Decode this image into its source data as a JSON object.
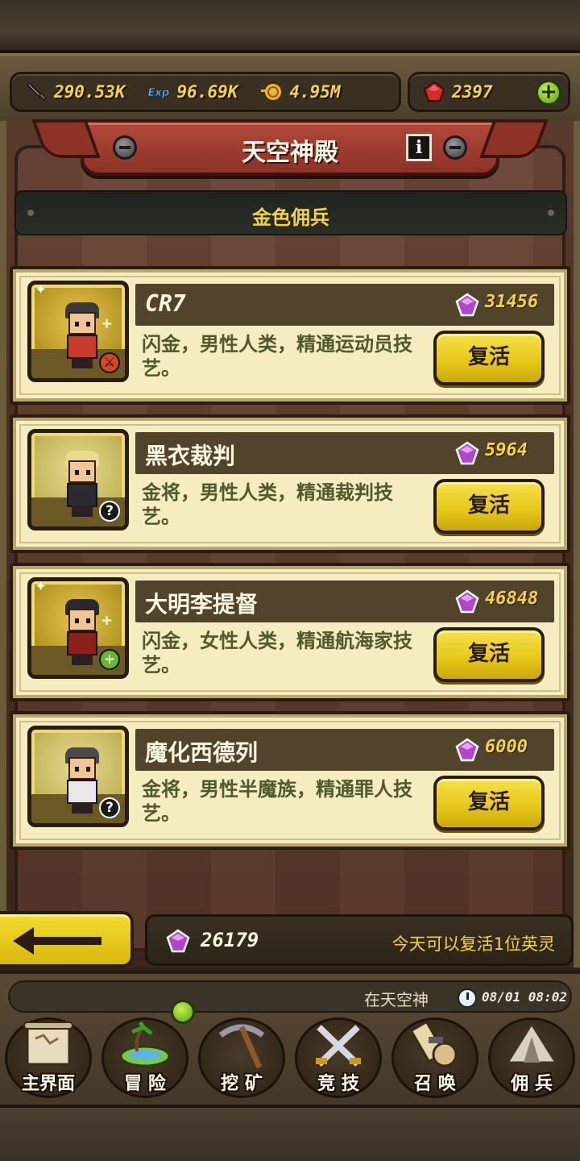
{
  "resources": {
    "attack": "290.53K",
    "exp": "96.69K",
    "gold": "4.95M",
    "gems": "2397"
  },
  "header": {
    "title": "天空神殿",
    "info_glyph": "i"
  },
  "section": {
    "label": "金色佣兵"
  },
  "heroes": [
    {
      "name": "CR7",
      "cost": "31456",
      "description": "闪金，男性人类，精通运动员技艺。",
      "button": "复活",
      "badge": "sword-icon",
      "hair_color": "#3a3a3a",
      "outfit_color": "#c83a2a"
    },
    {
      "name": "黑衣裁判",
      "cost": "5964",
      "description": "金将，男性人类，精通裁判技艺。",
      "button": "复活",
      "badge": "question-icon",
      "hair_color": "#e8dc8a",
      "outfit_color": "#2a2a30"
    },
    {
      "name": "大明李提督",
      "cost": "46848",
      "description": "闪金，女性人类，精通航海家技艺。",
      "button": "复活",
      "badge": "plus-icon",
      "hair_color": "#2a2a2e",
      "outfit_color": "#8a2018"
    },
    {
      "name": "魔化西德列",
      "cost": "6000",
      "description": "金将，男性半魔族，精通罪人技艺。",
      "button": "复活",
      "badge": "question-icon",
      "hair_color": "#4a4a4e",
      "outfit_color": "#e8e8ec"
    }
  ],
  "footer": {
    "total_gems": "26179",
    "revive_note": "今天可以复活1位英灵"
  },
  "status": {
    "location": "在天空神",
    "datetime": "08/01 08:02"
  },
  "nav": [
    {
      "label": "主界面",
      "icon": "map-scroll-icon"
    },
    {
      "label": "冒 险",
      "icon": "island-icon"
    },
    {
      "label": "挖 矿",
      "icon": "pickaxe-icon"
    },
    {
      "label": "竞 技",
      "icon": "crossed-swords-icon"
    },
    {
      "label": "召 唤",
      "icon": "summon-scroll-icon"
    },
    {
      "label": "佣 兵",
      "icon": "tent-icon"
    }
  ],
  "colors": {
    "accent_yellow": "#f2d34a",
    "banner_red": "#a84234",
    "card_bg": "#f4ecc2",
    "button_yellow": "#e6c618",
    "gem_purple": "#b046c8"
  }
}
